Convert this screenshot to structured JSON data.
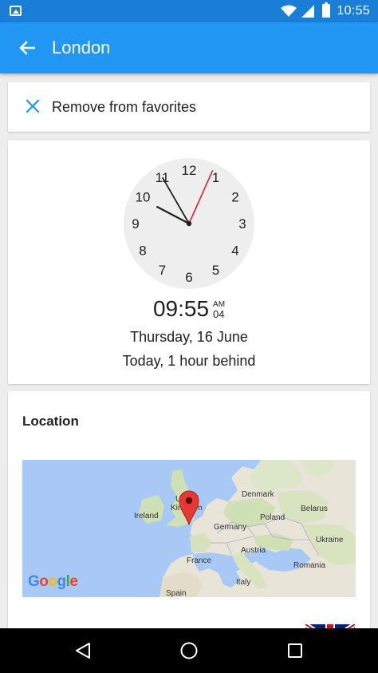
{
  "status_bar": {
    "time": "10:55"
  },
  "app_bar": {
    "title": "London"
  },
  "favorites": {
    "label": "Remove from favorites"
  },
  "clock": {
    "numbers": [
      "12",
      "1",
      "2",
      "3",
      "4",
      "5",
      "6",
      "7",
      "8",
      "9",
      "10",
      "11"
    ],
    "digital_time": "09:55",
    "ampm": "AM",
    "seconds": "04",
    "date": "Thursday, 16 June",
    "difference": "Today, 1 hour behind",
    "hour_value": 9.92,
    "minute_value": 55,
    "second_value": 4,
    "colors": {
      "second_hand": "#E8193C",
      "face": "#EEEEEE",
      "hands": "#212121"
    }
  },
  "location": {
    "heading": "Location",
    "map_labels": {
      "denmark": "Denmark",
      "belarus": "Belarus",
      "ireland": "Ireland",
      "uk": "Kingdom",
      "uk_top": "United",
      "poland": "Poland",
      "germany": "Germany",
      "ukraine": "Ukraine",
      "austria": "Austria",
      "france": "France",
      "romania": "Romania",
      "italy": "Italy",
      "spain": "Spain"
    },
    "google_logo": [
      "G",
      "o",
      "o",
      "g",
      "l",
      "e"
    ]
  },
  "colors": {
    "app_bar": "#2196F3",
    "status_bar": "#1A7ED6",
    "accent": "#2196F3",
    "marker": "#E53935"
  }
}
